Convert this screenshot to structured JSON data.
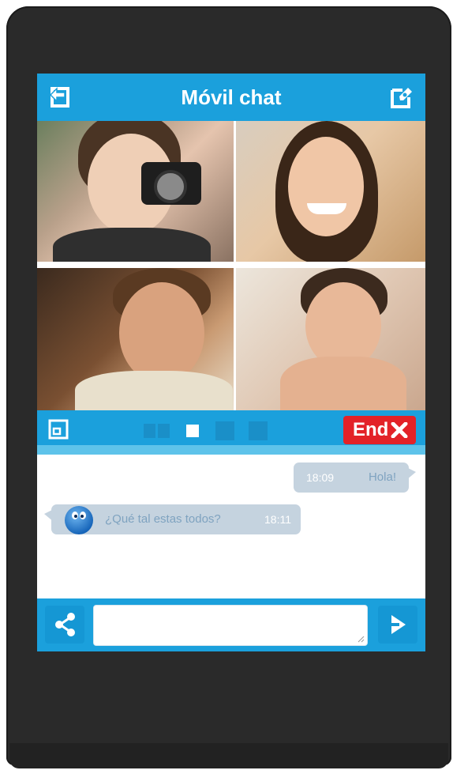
{
  "header": {
    "title": "Móvil chat",
    "back_icon": "exit-icon",
    "edit_icon": "edit-compose-icon"
  },
  "video_grid": {
    "participants": [
      {
        "name_hidden": true
      },
      {
        "name_hidden": true
      },
      {
        "name_hidden": true
      },
      {
        "name_hidden": true
      }
    ]
  },
  "call_controls": {
    "fullscreen_icon": "fullscreen-icon",
    "end_label": "End",
    "end_icon": "close-x-icon"
  },
  "chat": {
    "messages": [
      {
        "side": "right",
        "time": "18:09",
        "text": "Hola!"
      },
      {
        "side": "left",
        "time": "18:11",
        "text": "¿Qué tal estas todos?"
      }
    ]
  },
  "composer": {
    "input_value": "",
    "input_placeholder": "",
    "share_icon": "share-icon",
    "send_icon": "send-arrow-icon"
  },
  "colors": {
    "accent": "#1ba0dc",
    "end_red": "#e32228",
    "bubble": "#c5d3df"
  }
}
